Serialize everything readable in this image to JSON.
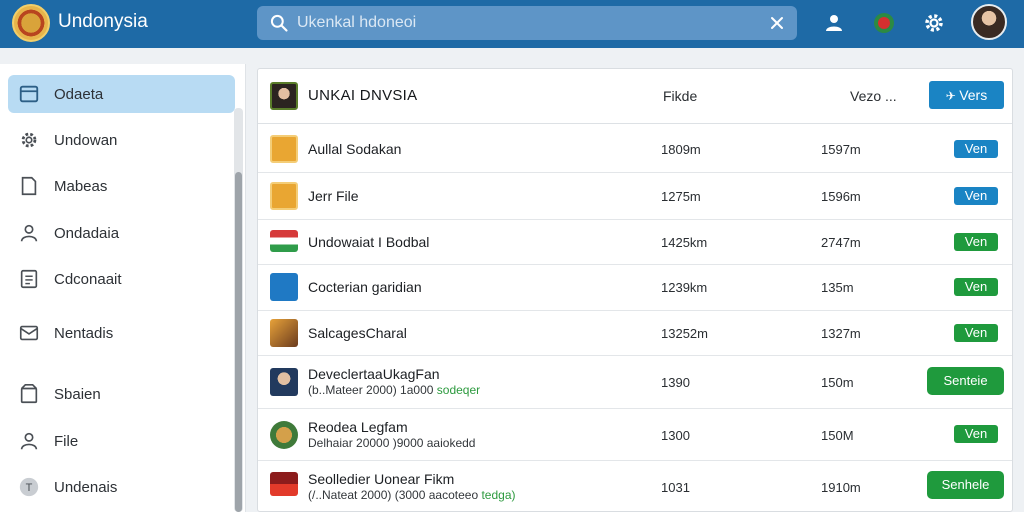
{
  "app": {
    "title": "Undonysia"
  },
  "search": {
    "placeholder": "Ukenkal hdoneoi"
  },
  "sidebar": {
    "items": [
      {
        "label": "Odaeta",
        "icon": "window-icon",
        "active": true
      },
      {
        "label": "Undowan",
        "icon": "gear-icon"
      },
      {
        "label": "Mabeas",
        "icon": "document-icon"
      },
      {
        "label": "Ondadaia",
        "icon": "person-icon"
      },
      {
        "label": "Cdconaait",
        "icon": "list-icon"
      },
      {
        "label": "Nentadis",
        "icon": "mail-icon"
      },
      {
        "label": "Sbaien",
        "icon": "box-icon"
      },
      {
        "label": "File",
        "icon": "user-icon"
      },
      {
        "label": "Undenais",
        "icon": "t-circle-icon"
      }
    ]
  },
  "table": {
    "header": {
      "name": "UNKAI DNVSIA",
      "col1": "Fikde",
      "col2": "Vezo ...",
      "button": "Vers"
    },
    "rows": [
      {
        "name": "Aullal Sodakan",
        "col1": "1809m",
        "col2": "1597m",
        "button": "Ven",
        "style": "blue",
        "icon": "folder-icon"
      },
      {
        "name": "Jerr File",
        "col1": "1275m",
        "col2": "1596m",
        "button": "Ven",
        "style": "blue",
        "icon": "file-icon"
      },
      {
        "name": "Undowaiat I Bodbal",
        "col1": "1425km",
        "col2": "2747m",
        "button": "Ven",
        "style": "green",
        "icon": "flag-icon"
      },
      {
        "name": "Cocterian garidian",
        "col1": "1239km",
        "col2": "135m",
        "button": "Ven",
        "style": "green",
        "icon": "shield-icon"
      },
      {
        "name": "SalcagesCharal",
        "col1": "13252m",
        "col2": "1327m",
        "button": "Ven",
        "style": "green",
        "icon": "photo-icon"
      },
      {
        "name": "DeveclertaaUkagFan",
        "sub": "(b..Mateer 2000) 1a000",
        "tag": "sodeqer",
        "col1": "1390",
        "col2": "150m",
        "button": "Senteie",
        "style": "green",
        "icon": "portrait-icon"
      },
      {
        "name": "Reodea Legfam",
        "sub": "Delhaiar 20000 )9000 aaiokedd",
        "col1": "1300",
        "col2": "150M",
        "button": "Ven",
        "style": "green",
        "icon": "emblem-icon"
      },
      {
        "name": "Seolledier Uonear Fikm",
        "sub": "(/..Nateat 2000) (3000 aacoteeo",
        "tag": "tedga)",
        "col1": "1031",
        "col2": "1910m",
        "button": "Senhele",
        "style": "green",
        "icon": "flag-icon"
      }
    ]
  }
}
